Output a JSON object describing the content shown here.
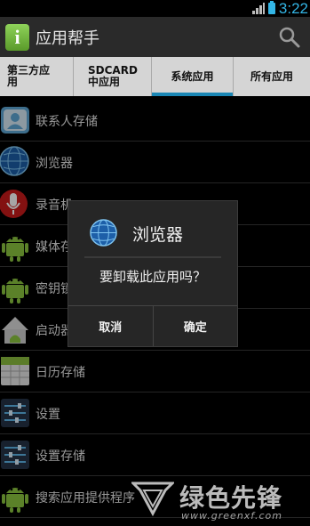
{
  "status_bar": {
    "time": "3:22",
    "signal_icon": "signal-icon",
    "battery_icon": "battery-icon"
  },
  "action_bar": {
    "app_icon_letter": "i",
    "title": "应用帮手",
    "search_icon": "search-icon"
  },
  "tabs": [
    {
      "line1": "第三方应",
      "line2": "用",
      "active": false
    },
    {
      "line1": "SDCARD",
      "line2": "中应用",
      "active": false
    },
    {
      "line1": "系统应用",
      "line2": "",
      "active": true
    },
    {
      "line1": "所有应用",
      "line2": "",
      "active": false
    }
  ],
  "apps": [
    {
      "label": "联系人存储",
      "icon": "contacts-icon"
    },
    {
      "label": "浏览器",
      "icon": "globe-icon"
    },
    {
      "label": "录音机",
      "icon": "microphone-icon"
    },
    {
      "label": "媒体存",
      "icon": "android-icon"
    },
    {
      "label": "密钥锁",
      "icon": "android-icon"
    },
    {
      "label": "启动器",
      "icon": "home-icon"
    },
    {
      "label": "日历存储",
      "icon": "calendar-icon"
    },
    {
      "label": "设置",
      "icon": "settings-icon"
    },
    {
      "label": "设置存储",
      "icon": "settings-icon"
    },
    {
      "label": "搜索应用提供程序",
      "icon": "android-icon"
    }
  ],
  "dialog": {
    "title": "浏览器",
    "icon": "globe-icon",
    "message": "要卸载此应用吗？",
    "cancel_label": "取消",
    "confirm_label": "确定"
  },
  "watermark": {
    "title": "绿色先锋",
    "url": "www.greenxf.com"
  },
  "colors": {
    "accent": "#1a86b4",
    "clock": "#33b5e5",
    "tab_bg": "#d5d5d5",
    "action_bar_bg": "#2a2a2a"
  }
}
